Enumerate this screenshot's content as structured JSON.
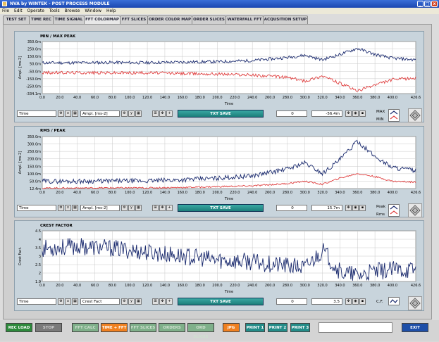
{
  "window": {
    "title": "NVA by WINTEK - POST PROCESS MODULE",
    "btn_min": "_",
    "btn_max": "□",
    "btn_close": "x"
  },
  "menu": [
    "File",
    "Edit",
    "Operate",
    "Tools",
    "Browse",
    "Window",
    "Help"
  ],
  "tabs": [
    {
      "label": "TEST SET"
    },
    {
      "label": "TIME REC"
    },
    {
      "label": "TIME SIGNAL"
    },
    {
      "label": "FFT COLORMAP"
    },
    {
      "label": "FFT SLICES"
    },
    {
      "label": "ORDER COLOR MAP"
    },
    {
      "label": "ORDER SLICES"
    },
    {
      "label": "WATERFALL FFT"
    },
    {
      "label": "ACQUSITION SETUP"
    }
  ],
  "chart1": {
    "title": "MIN / MAX PEAK",
    "xlabel": "Time",
    "ylabel": "Ampl. [ms-2]",
    "yticks": [
      "350.0m",
      "250.0m",
      "150.0m",
      "50.0m",
      "-50.0m",
      "-150.0m",
      "-250.0m",
      "-334.1m"
    ],
    "ctrl": {
      "x_name": "Time",
      "y_name": "Ampl. [ms-2]",
      "save": "TXT SAVE",
      "cursor_x": "0",
      "cursor_y": "-56.4m"
    },
    "legend": [
      "MAX",
      "MIN"
    ]
  },
  "chart2": {
    "title": "RMS / PEAK",
    "xlabel": "Time",
    "ylabel": "Ampl. [ms-2]",
    "yticks": [
      "350.0m",
      "300.0m",
      "250.0m",
      "200.0m",
      "150.0m",
      "100.0m",
      "50.0m",
      "12.4m"
    ],
    "ctrl": {
      "x_name": "Time",
      "y_name": "Ampl. [ms-2]",
      "save": "TXT SAVE",
      "cursor_x": "0",
      "cursor_y": "15.7m"
    },
    "legend": [
      "Peak",
      "Rms"
    ]
  },
  "chart3": {
    "title": "CREST FACTOR",
    "xlabel": "Time",
    "ylabel": "Crest Fact.",
    "yticks": [
      "4.5",
      "4",
      "3.5",
      "3",
      "2.5",
      "2",
      "1.9"
    ],
    "ctrl": {
      "x_name": "Time",
      "y_name": "Crest Fact",
      "save": "TXT SAVE",
      "cursor_x": "0",
      "cursor_y": "3.5"
    },
    "legend": [
      "C.F."
    ]
  },
  "xticks": [
    "0.0",
    "20.0",
    "40.0",
    "60.0",
    "80.0",
    "100.0",
    "120.0",
    "140.0",
    "160.0",
    "180.0",
    "200.0",
    "220.0",
    "240.0",
    "260.0",
    "280.0",
    "300.0",
    "320.0",
    "340.0",
    "360.0",
    "380.0",
    "400.0",
    "426.6"
  ],
  "buttons": {
    "rec_load": "REC LOAD",
    "stop": "STOP",
    "fft_calc": "FFT CALC",
    "time_fft": "TIME + FFT",
    "fft_slices": "FFT SLICES",
    "orders": "ORDERS",
    "ord_slices": "ORD SLICES",
    "jpg": "JPG",
    "print1": "PRINT 1",
    "print2": "PRINT 2",
    "print3": "PRINT 3",
    "exit": "EXIT"
  },
  "colors": {
    "max": "#1a2a6e",
    "min": "#e04040",
    "teal": "#238c88",
    "green": "#2d8a3c"
  },
  "chart_data": [
    {
      "type": "line",
      "title": "MIN / MAX PEAK",
      "xlabel": "Time",
      "ylabel": "Ampl. [ms-2]",
      "xlim": [
        0,
        426.6
      ],
      "ylim": [
        -334.1,
        350
      ],
      "series": [
        {
          "name": "MAX",
          "x": [
            0,
            40,
            80,
            120,
            160,
            200,
            240,
            280,
            300,
            320,
            340,
            360,
            380,
            400,
            426.6
          ],
          "y": [
            70,
            72,
            75,
            72,
            80,
            85,
            100,
            140,
            170,
            110,
            180,
            260,
            180,
            130,
            110
          ]
        },
        {
          "name": "MIN",
          "x": [
            0,
            40,
            80,
            120,
            160,
            200,
            240,
            280,
            300,
            320,
            340,
            360,
            380,
            400,
            426.6
          ],
          "y": [
            -60,
            -58,
            -62,
            -60,
            -70,
            -75,
            -90,
            -120,
            -170,
            -100,
            -200,
            -300,
            -220,
            -150,
            -130
          ]
        }
      ]
    },
    {
      "type": "line",
      "title": "RMS / PEAK",
      "xlabel": "Time",
      "ylabel": "Ampl. [ms-2]",
      "xlim": [
        0,
        426.6
      ],
      "ylim": [
        12.4,
        350
      ],
      "series": [
        {
          "name": "Peak",
          "x": [
            0,
            40,
            80,
            120,
            160,
            200,
            240,
            280,
            300,
            320,
            340,
            360,
            380,
            400,
            426.6
          ],
          "y": [
            60,
            60,
            62,
            62,
            70,
            80,
            95,
            140,
            180,
            110,
            200,
            320,
            220,
            150,
            130
          ]
        },
        {
          "name": "Rms",
          "x": [
            0,
            40,
            80,
            120,
            160,
            200,
            240,
            280,
            300,
            320,
            340,
            360,
            380,
            400,
            426.6
          ],
          "y": [
            15,
            16,
            17,
            17,
            20,
            25,
            30,
            45,
            60,
            40,
            80,
            110,
            90,
            60,
            55
          ]
        }
      ]
    },
    {
      "type": "line",
      "title": "CREST FACTOR",
      "xlabel": "Time",
      "ylabel": "Crest Fact.",
      "xlim": [
        0,
        426.6
      ],
      "ylim": [
        1.9,
        4.5
      ],
      "series": [
        {
          "name": "C.F.",
          "x": [
            0,
            40,
            80,
            120,
            160,
            200,
            240,
            280,
            300,
            320,
            340,
            360,
            380,
            400,
            426.6
          ],
          "y": [
            3.6,
            3.7,
            3.6,
            3.4,
            3.2,
            3.0,
            2.9,
            2.7,
            2.6,
            3.5,
            2.4,
            2.2,
            2.4,
            2.5,
            2.5
          ]
        }
      ]
    }
  ]
}
